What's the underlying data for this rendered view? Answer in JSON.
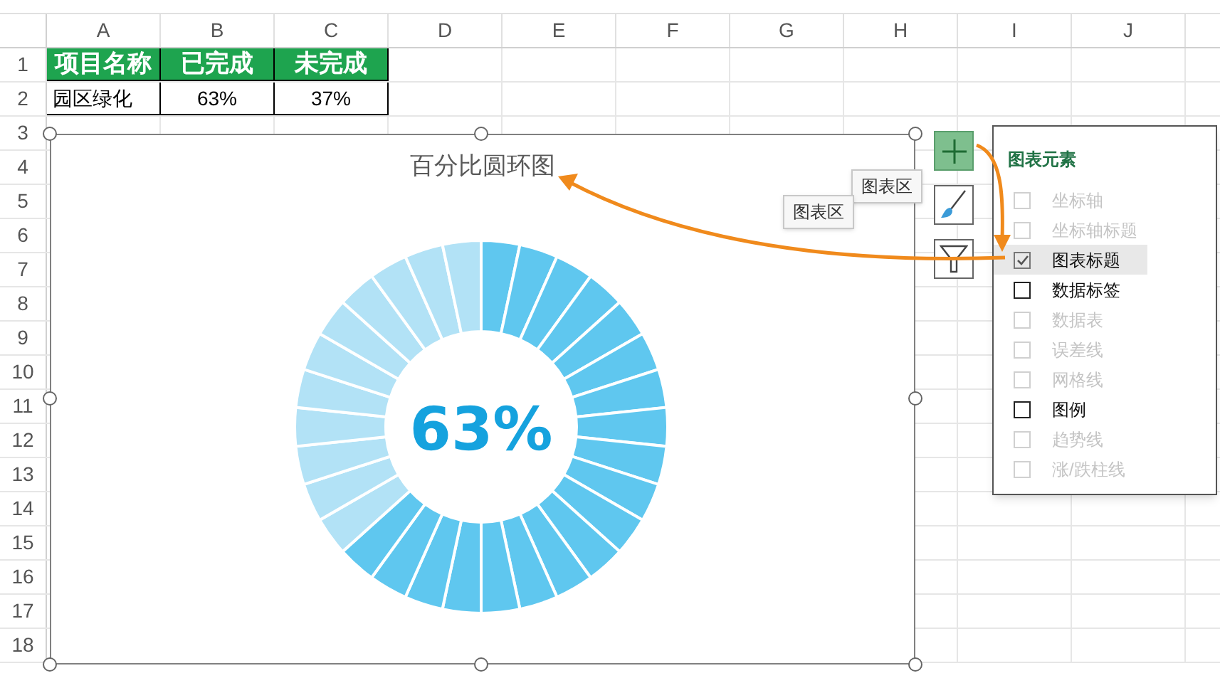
{
  "columns": [
    "A",
    "B",
    "C",
    "D",
    "E",
    "F",
    "G",
    "H",
    "I",
    "J"
  ],
  "rows": [
    "1",
    "2",
    "3",
    "4",
    "5",
    "6",
    "7",
    "8",
    "9",
    "10",
    "11",
    "12",
    "13",
    "14",
    "15",
    "16",
    "17",
    "18"
  ],
  "table": {
    "header": [
      "项目名称",
      "已完成",
      "未完成"
    ],
    "rows": [
      [
        "园区绿化",
        "63%",
        "37%"
      ]
    ]
  },
  "chart": {
    "title": "百分比圆环图",
    "center_label": "63%"
  },
  "tooltips": [
    "图表区",
    "图表区"
  ],
  "side_buttons": [
    {
      "kind": "add",
      "selected": true
    },
    {
      "kind": "style",
      "selected": false
    },
    {
      "kind": "filter",
      "selected": false
    }
  ],
  "panel": {
    "title": "图表元素",
    "items": [
      {
        "label": "坐标轴",
        "checked": false,
        "disabled": true,
        "selected": false
      },
      {
        "label": "坐标轴标题",
        "checked": false,
        "disabled": true,
        "selected": false
      },
      {
        "label": "图表标题",
        "checked": true,
        "disabled": false,
        "selected": true
      },
      {
        "label": "数据标签",
        "checked": false,
        "disabled": false,
        "selected": false
      },
      {
        "label": "数据表",
        "checked": false,
        "disabled": true,
        "selected": false
      },
      {
        "label": "误差线",
        "checked": false,
        "disabled": true,
        "selected": false
      },
      {
        "label": "网格线",
        "checked": false,
        "disabled": true,
        "selected": false
      },
      {
        "label": "图例",
        "checked": false,
        "disabled": false,
        "selected": false
      },
      {
        "label": "趋势线",
        "checked": false,
        "disabled": true,
        "selected": false
      },
      {
        "label": "涨/跌柱线",
        "checked": false,
        "disabled": true,
        "selected": false
      }
    ]
  }
}
